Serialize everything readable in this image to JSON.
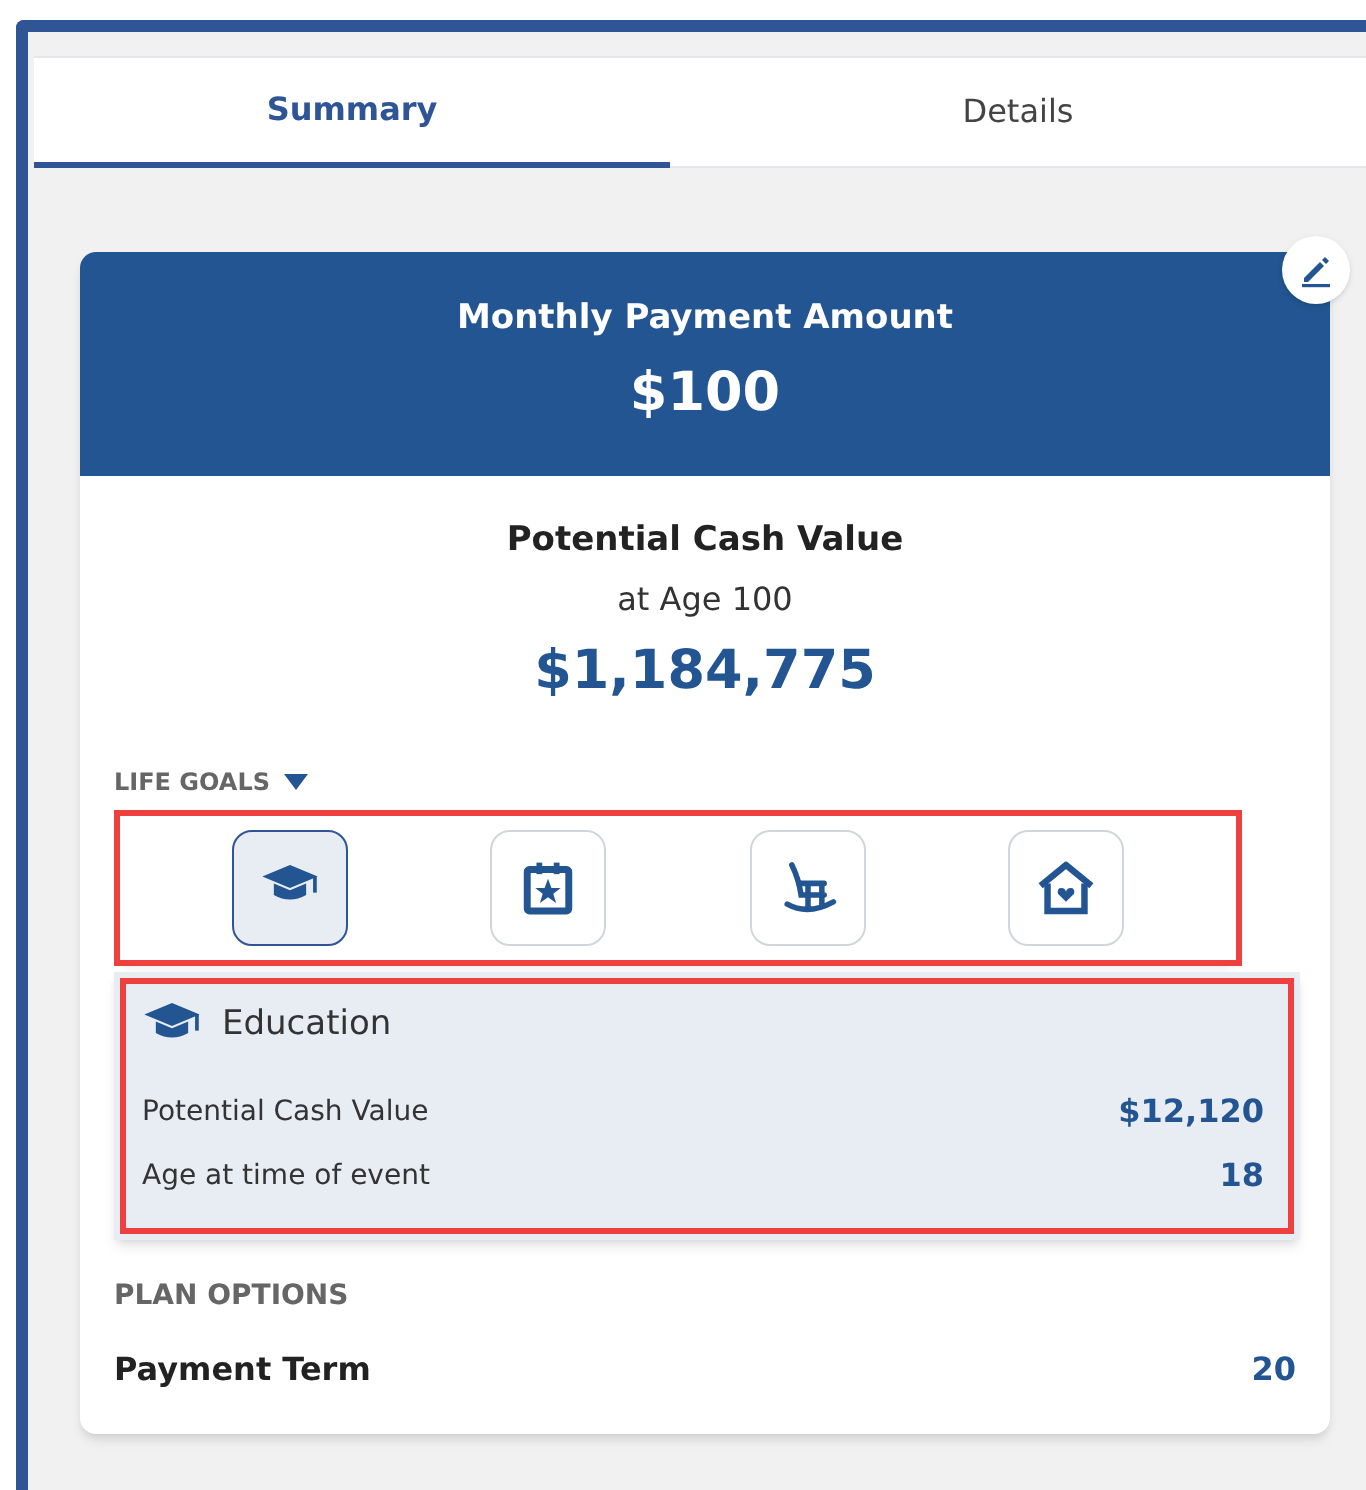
{
  "tabs": [
    {
      "label": "Summary",
      "selected": true
    },
    {
      "label": "Details",
      "selected": false
    }
  ],
  "payment": {
    "title": "Monthly Payment Amount",
    "amount": "$100"
  },
  "cash_value": {
    "title": "Potential Cash Value",
    "subtitle": "at Age 100",
    "amount": "$1,184,775"
  },
  "life_goals": {
    "label": "LIFE GOALS",
    "expanded": true,
    "highlighted": true,
    "items": [
      {
        "kind": "education",
        "selected": true
      },
      {
        "kind": "event",
        "selected": false
      },
      {
        "kind": "retirement",
        "selected": false
      },
      {
        "kind": "home",
        "selected": false
      }
    ]
  },
  "goal_detail": {
    "kind": "education",
    "title": "Education",
    "highlighted": true,
    "rows": [
      {
        "label": "Potential Cash Value",
        "value": "$12,120"
      },
      {
        "label": "Age at time of event",
        "value": "18"
      }
    ]
  },
  "plan_options": {
    "label": "PLAN OPTIONS",
    "rows": [
      {
        "label": "Payment Term",
        "value": "20"
      }
    ]
  }
}
